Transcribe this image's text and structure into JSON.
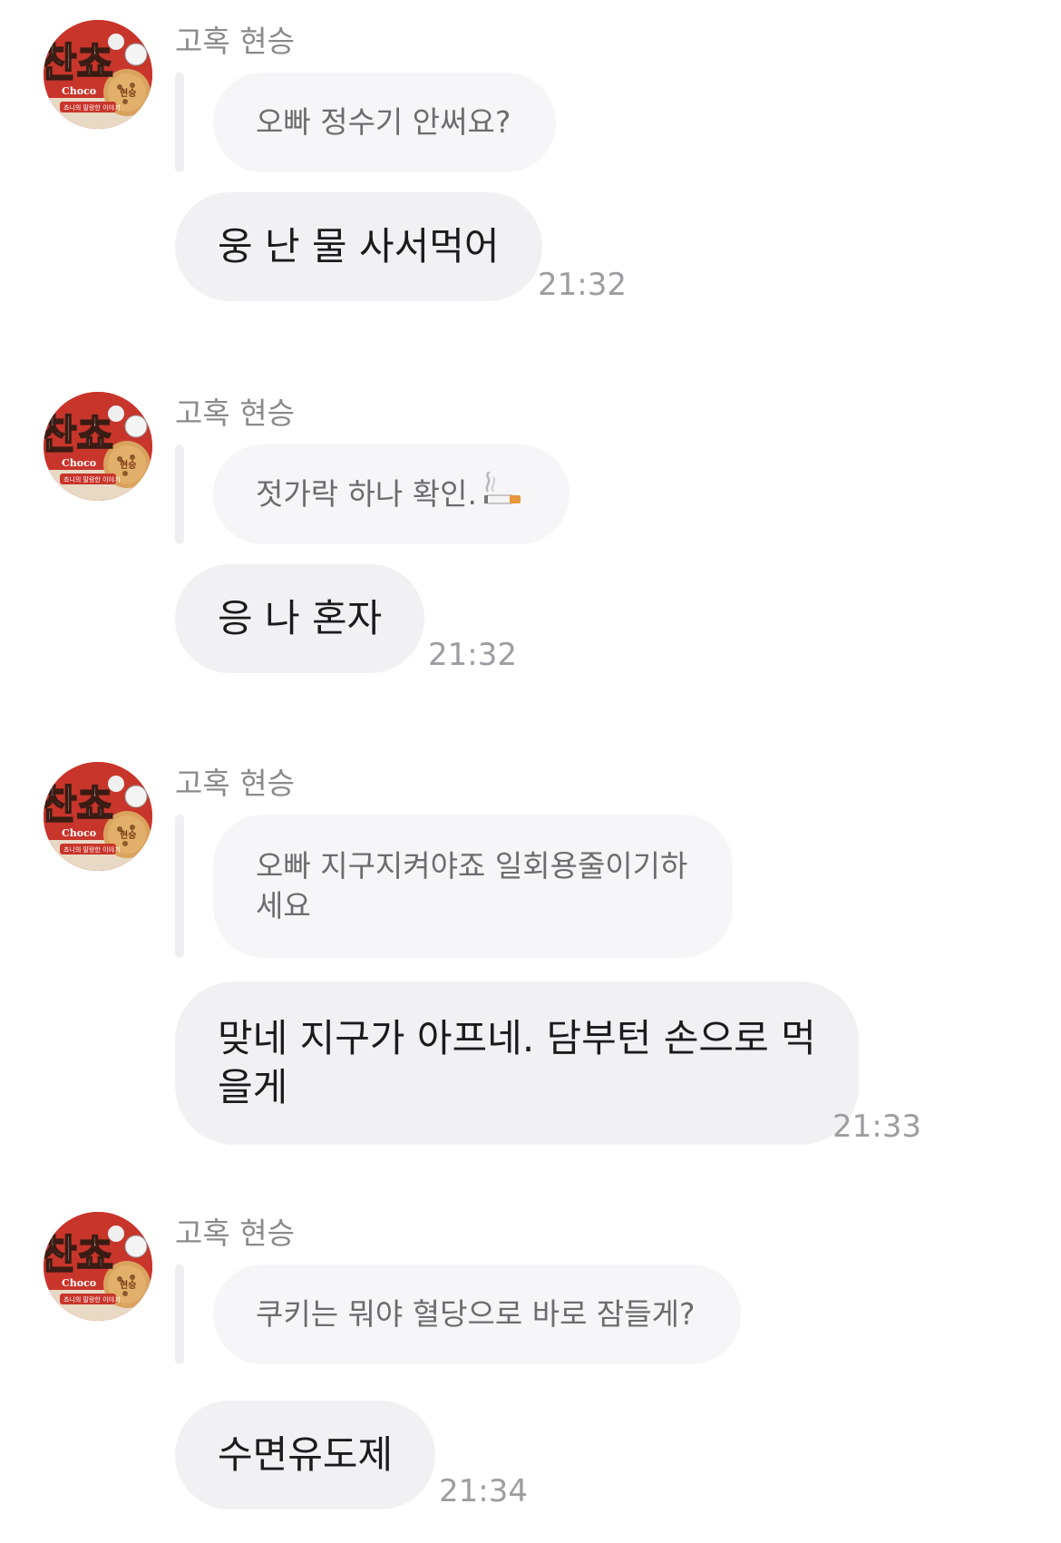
{
  "sender_name": "고혹 현승",
  "avatar": {
    "icon": "cookie-avatar-icon",
    "logo_text": "찬쵸",
    "brand_text": "Choco",
    "sub_text": "쵸니의 말랑한 이야기",
    "badge_text": "현승"
  },
  "messages": [
    {
      "quote": "오빠 정수기 안써요?",
      "reply": "웅 난 물 사서먹어",
      "time": "21:32"
    },
    {
      "quote": "젓가락 하나 확인.",
      "quote_emoji": "cigarette-icon",
      "reply": "응 나 혼자",
      "time": "21:32"
    },
    {
      "quote": "오빠 지구지켜야죠 일회용줄이기하\n세요",
      "reply": "맞네 지구가 아프네. 담부턴 손으로 먹\n을게",
      "time": "21:33"
    },
    {
      "quote": "쿠키는 뭐야 혈당으로 바로 잠들게?",
      "reply": "수면유도제",
      "time": "21:34"
    }
  ],
  "colors": {
    "reply_bg": "#f1f1f4",
    "quote_bg": "#f6f6f8",
    "avatar_red": "#c8352b"
  }
}
